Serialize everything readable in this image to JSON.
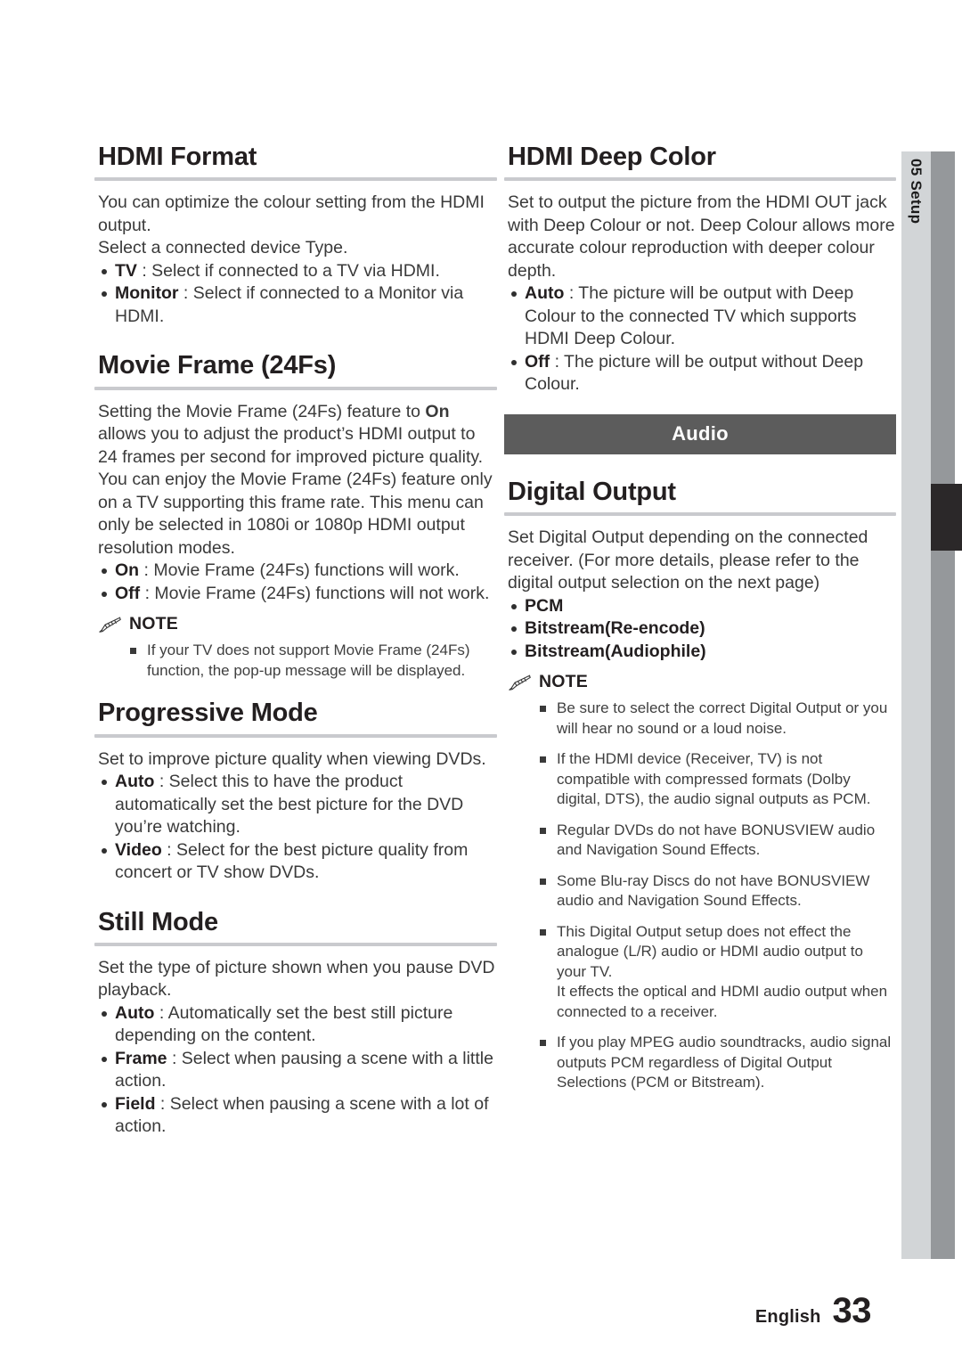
{
  "side_tab": {
    "chapter_number": "05",
    "chapter_name": "Setup",
    "label": "05  Setup"
  },
  "left_column": {
    "hdmi_format": {
      "title": "HDMI Format",
      "paragraph": "You can optimize the colour setting from the HDMI output.\nSelect a connected device Type.",
      "bullets": [
        {
          "term": "TV",
          "text": " : Select if connected to a TV via HDMI."
        },
        {
          "term": "Monitor",
          "text": " : Select if connected to a Monitor via HDMI."
        }
      ]
    },
    "movie_frame": {
      "title": "Movie Frame (24Fs)",
      "paragraph_pre": "Setting the Movie Frame (24Fs) feature to ",
      "paragraph_bold": "On",
      "paragraph_post": " allows you to adjust the product’s HDMI output to 24 frames per second for improved picture quality. You can enjoy the Movie Frame (24Fs) feature only on a TV supporting this frame rate. This menu can only be selected in 1080i or 1080p HDMI output resolution modes.",
      "bullets": [
        {
          "term": "On",
          "text": " : Movie Frame (24Fs) functions will work."
        },
        {
          "term": "Off",
          "text": " : Movie Frame (24Fs) functions will not work."
        }
      ],
      "note": {
        "title": "NOTE",
        "icon": "pencil-icon",
        "items": [
          "If your TV does not support Movie Frame (24Fs) function, the pop-up message will be displayed."
        ]
      }
    },
    "progressive_mode": {
      "title": "Progressive Mode",
      "paragraph": "Set to improve picture quality when viewing DVDs.",
      "bullets": [
        {
          "term": "Auto",
          "text": " : Select this to have the product automatically set the best picture for the DVD you’re watching."
        },
        {
          "term": "Video",
          "text": " : Select for the best picture quality from concert or TV show DVDs."
        }
      ]
    },
    "still_mode": {
      "title": "Still Mode",
      "paragraph": "Set the type of picture shown when you pause DVD playback.",
      "bullets": [
        {
          "term": "Auto",
          "text": " : Automatically set the best still picture depending on the content."
        },
        {
          "term": "Frame",
          "text": " : Select when pausing a scene with a little action."
        },
        {
          "term": "Field",
          "text": " : Select when pausing a scene with a lot of action."
        }
      ]
    }
  },
  "right_column": {
    "hdmi_deep_color": {
      "title": "HDMI Deep Color",
      "paragraph": "Set to output the picture from the HDMI OUT jack with Deep Colour or not. Deep Colour allows more accurate colour reproduction with deeper colour depth.",
      "bullets": [
        {
          "term": "Auto",
          "text": " : The picture will be output with Deep Colour to the connected TV which supports HDMI Deep Colour."
        },
        {
          "term": "Off",
          "text": " : The picture will be output without Deep Colour."
        }
      ]
    },
    "audio_banner": "Audio",
    "digital_output": {
      "title": "Digital Output",
      "paragraph": "Set Digital Output depending on the connected receiver. (For more details, please refer to the digital output selection on the next page)",
      "bullets": [
        "PCM",
        "Bitstream(Re-encode)",
        "Bitstream(Audiophile)"
      ],
      "note": {
        "title": "NOTE",
        "icon": "pencil-icon",
        "items": [
          "Be sure to select the correct Digital Output or you will hear no sound or a loud noise.",
          "If the HDMI device (Receiver, TV) is not compatible with compressed formats (Dolby digital, DTS), the audio signal outputs as PCM.",
          "Regular DVDs do not have BONUSVIEW audio and Navigation Sound Effects.",
          "Some Blu-ray Discs do not have BONUSVIEW audio and Navigation Sound Effects.",
          "This Digital Output setup does not effect the analogue (L/R) audio or HDMI audio output to your TV.\nIt effects the optical and HDMI audio output when connected to a receiver.",
          "If you play MPEG audio soundtracks, audio signal outputs PCM regardless of Digital Output Selections (PCM or Bitstream)."
        ]
      }
    }
  },
  "footer": {
    "language": "English",
    "page_number": "33"
  },
  "colors": {
    "banner_bg": "#5c5c5c",
    "rule": "#c9cace",
    "side_tab_light": "#d2d5d7",
    "side_tab_dark": "#95989b",
    "side_marker": "#2b2829",
    "body_text": "#3a3a3a",
    "heading_text": "#231f20"
  }
}
